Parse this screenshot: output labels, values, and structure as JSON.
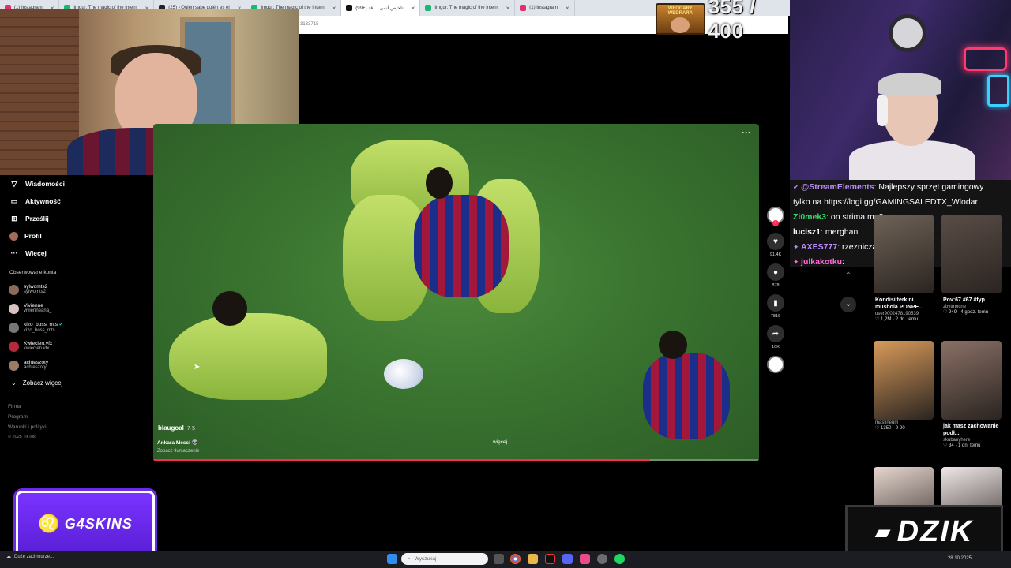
{
  "browser": {
    "tabs": [
      {
        "label": "(1) Instagram",
        "color": "#e1306c",
        "active": false
      },
      {
        "label": "Imgur: The magic of the Intern",
        "color": "#1bb76e",
        "active": false
      },
      {
        "label": "(25) ¿Quién sabe quién es el",
        "color": "#222222",
        "active": false
      },
      {
        "label": "Imgur: The magic of the Intern",
        "color": "#1bb76e",
        "active": false
      },
      {
        "label": "(99+) تلخيص أنمي ... قد",
        "color": "#111111",
        "active": true
      },
      {
        "label": "Imgur: The magic of the Intern",
        "color": "#1bb76e",
        "active": false
      },
      {
        "label": "(1) Instagram",
        "color": "#e1306c",
        "active": false
      }
    ],
    "url_fragment": "3133718"
  },
  "counter": {
    "badge_text": "WŁODARY WEDRARA",
    "value": "355 / 400"
  },
  "nav": {
    "items": [
      {
        "icon": "send-icon",
        "glyph": "▽",
        "label": "Wiadomości"
      },
      {
        "icon": "activity-icon",
        "glyph": "▭",
        "label": "Aktywność"
      },
      {
        "icon": "upload-icon",
        "glyph": "⊞",
        "label": "Prześlij"
      },
      {
        "icon": "profile-avatar",
        "glyph": "",
        "label": "Profil"
      },
      {
        "icon": "more-icon",
        "glyph": "···",
        "label": "Więcej"
      }
    ],
    "followed_title": "Obserwowane konta",
    "accounts": [
      {
        "name": "sylwomts2",
        "handle": "sylwomts2",
        "color": "#8b6a5a",
        "verified": false
      },
      {
        "name": "Vivienne",
        "handle": "vivienneana_",
        "color": "#d9c2c2",
        "verified": false
      },
      {
        "name": "kizo_boss_mts",
        "handle": "kizo_boss_mts",
        "color": "#777777",
        "verified": true
      },
      {
        "name": "Kwiecien.vfx",
        "handle": "kwiecien.vfx",
        "color": "#b12b3a",
        "verified": false
      },
      {
        "name": "achteszoty",
        "handle": "achteszoty",
        "color": "#9a7b66",
        "verified": false
      }
    ],
    "see_more": "Zobacz więcej",
    "footer": [
      "Firma",
      "Program",
      "Warunki i polityki"
    ],
    "copyright": "© 2025 TikTok"
  },
  "video": {
    "author": "blaugoal",
    "date": "7-5",
    "description": "Ankara Messi 👽",
    "translate": "Zobacz tłumaczenie",
    "more": "więcej",
    "progress": 0.82
  },
  "actions": [
    {
      "icon": "heart-icon",
      "glyph": "♥",
      "count": "91,4K"
    },
    {
      "icon": "comment-icon",
      "glyph": "●",
      "count": "878"
    },
    {
      "icon": "bookmark-icon",
      "glyph": "▮",
      "count": "7816"
    },
    {
      "icon": "share-icon",
      "glyph": "➦",
      "count": "10K"
    }
  ],
  "chat": [
    {
      "user": "@StreamElements",
      "color": "#b98cff",
      "text": "Najlepszy sprzęt gamingowy",
      "icon": "✔"
    },
    {
      "user": "",
      "color": "#ffffff",
      "text": "tylko na https://logi.gg/GAMINGSALEDTX_Wlodar",
      "icon": ""
    },
    {
      "user": "Zi0mek3",
      "color": "#3ad96a",
      "text": "on strima ma?",
      "icon": ""
    },
    {
      "user": "lucisz1",
      "color": "#ffffff",
      "text": "merghani",
      "icon": ""
    },
    {
      "user": "AXES777",
      "color": "#b98cff",
      "text": "rzezniczak",
      "icon": "✦"
    },
    {
      "user": "julkakotku",
      "color": "#ff6ad5",
      "text": "",
      "icon": "✦"
    }
  ],
  "recommended": [
    {
      "title": "Kondisi terkini mushola PONPE...",
      "user": "user9002478190539",
      "stats": "♡ 1,2M · 2 dn. temu",
      "bg": "#6f6358"
    },
    {
      "title": "Pov:67 #67 #fyp",
      "user": "zbytmocne",
      "stats": "♡ 949 · 4 godz. temu",
      "bg": "#5a4d47"
    },
    {
      "title": "",
      "user": "mastineum",
      "stats": "♡ 1350 · 9-20",
      "bg": "#d89a5a"
    },
    {
      "title": "jak masz zachowanie podł...",
      "user": "skubanyhere",
      "stats": "♡ 34 · 1 dn. temu",
      "bg": "#8a7066"
    },
    {
      "title": "",
      "user": "",
      "stats": "",
      "bg": "#e7d6cf"
    },
    {
      "title": "",
      "user": "",
      "stats": "",
      "bg": "#f0e8e8"
    }
  ],
  "ads": {
    "g4skins": "G4SKINS",
    "dzik": "DZIK"
  },
  "taskbar": {
    "weather": "Duże zachmurze...",
    "search_placeholder": "Wyszukaj",
    "date": "28.10.2025"
  }
}
